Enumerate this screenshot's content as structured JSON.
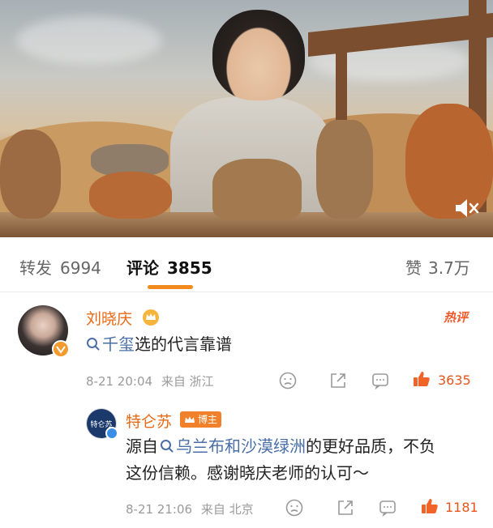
{
  "tabs": {
    "repost_label": "转发",
    "repost_count": "6994",
    "comment_label": "评论",
    "comment_count": "3855",
    "like_label": "赞",
    "like_count": "3.7万"
  },
  "comments": [
    {
      "username": "刘晓庆",
      "hot_label": "热评",
      "topic": "千玺",
      "text": "选的代言靠谱",
      "time": "8-21 20:04",
      "location": "来自 浙江",
      "likes": "3635"
    }
  ],
  "reply": {
    "username": "特仑苏",
    "tag": "博主",
    "avatar_text": "特仑苏",
    "text_prefix": "源自",
    "topic": "乌兰布和沙漠绿洲",
    "text_line1_suffix": "的更好品质，不负",
    "text_line2": "这份信赖。感谢晓庆老师的认可～",
    "time": "8-21 21:06",
    "location": "来自 北京",
    "likes": "1181"
  },
  "colors": {
    "accent": "#f28a1e",
    "username": "#e86a16",
    "topic": "#4a6fa8",
    "like": "#e8551c"
  },
  "icons": [
    "mute-icon",
    "search-icon",
    "crown-icon",
    "dislike-icon",
    "share-icon",
    "comment-icon",
    "like-icon"
  ]
}
